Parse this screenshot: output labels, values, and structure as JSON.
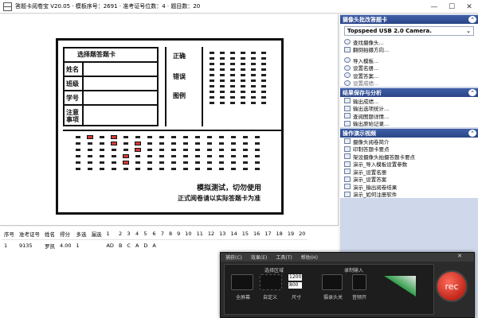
{
  "window": {
    "title": "答题卡阅卷宝 V20.05 · 模板序号：2691 · 准考证号位数：4 · 题目数：20",
    "min": "—",
    "max": "☐",
    "close": "✕"
  },
  "sheet": {
    "header_title": "选择题答题卡",
    "labels": [
      "姓名",
      "班级",
      "学号",
      "注意\n事项"
    ],
    "side_labels": [
      "正确",
      "错误",
      "图例"
    ],
    "footer_line1": "模拟测试，切勿使用",
    "footer_line2": "正式阅卷请以实际答题卡为准"
  },
  "table": {
    "headers": [
      "序号",
      "准考证号",
      "姓名",
      "得分",
      "多选",
      "漏选",
      "1",
      "2",
      "3",
      "4",
      "5",
      "6",
      "7",
      "8",
      "9",
      "10",
      "11",
      "12",
      "13",
      "14",
      "15",
      "16",
      "17",
      "18",
      "19",
      "20"
    ],
    "rows": [
      [
        "1",
        "9135",
        "罗凯",
        "4.00",
        "1",
        "",
        "AD",
        "B",
        "C",
        "A",
        "D",
        "A",
        "",
        "",
        "",
        "",
        "",
        "",
        "",
        "",
        "",
        "",
        "",
        "",
        "",
        ""
      ]
    ]
  },
  "panel": {
    "camera": {
      "header": "摄像头批改答题卡",
      "device": "Topspeed USB 2.0 Camera.",
      "items": [
        "查找摄像头...",
        "翻倒拍摄方向..."
      ],
      "items2": [
        "导入模板...",
        "设置名册...",
        "设置答案...",
        "设置成绩..."
      ]
    },
    "save": {
      "header": "结果保存与分析",
      "items": [
        "输出成绩...",
        "输出选项统计...",
        "查阅图题详情...",
        "输出原始记录..."
      ]
    },
    "demo": {
      "header": "操作演示视频",
      "items": [
        "摄像头阅卷简介",
        "印制答题卡要点",
        "架设摄像头拍摄答题卡要点",
        "演示_导入模板设置参数",
        "演示_设置名册",
        "演示_设置答案",
        "演示_输出阅卷结果",
        "演示_如何注册软件"
      ]
    }
  },
  "recorder": {
    "menu": [
      "捕获(C)",
      "效果(E)",
      "工具(T)",
      "帮助(H)"
    ],
    "close": "✕",
    "area_label": "选择区域",
    "fullscreen_label": "全屏幕",
    "custom_label": "自定义",
    "width": "1200",
    "height": "800",
    "size_label": "尺寸",
    "input_label": "录制输入",
    "camera_label": "摄录头关",
    "audio_label": "音频开",
    "rec": "rec"
  }
}
